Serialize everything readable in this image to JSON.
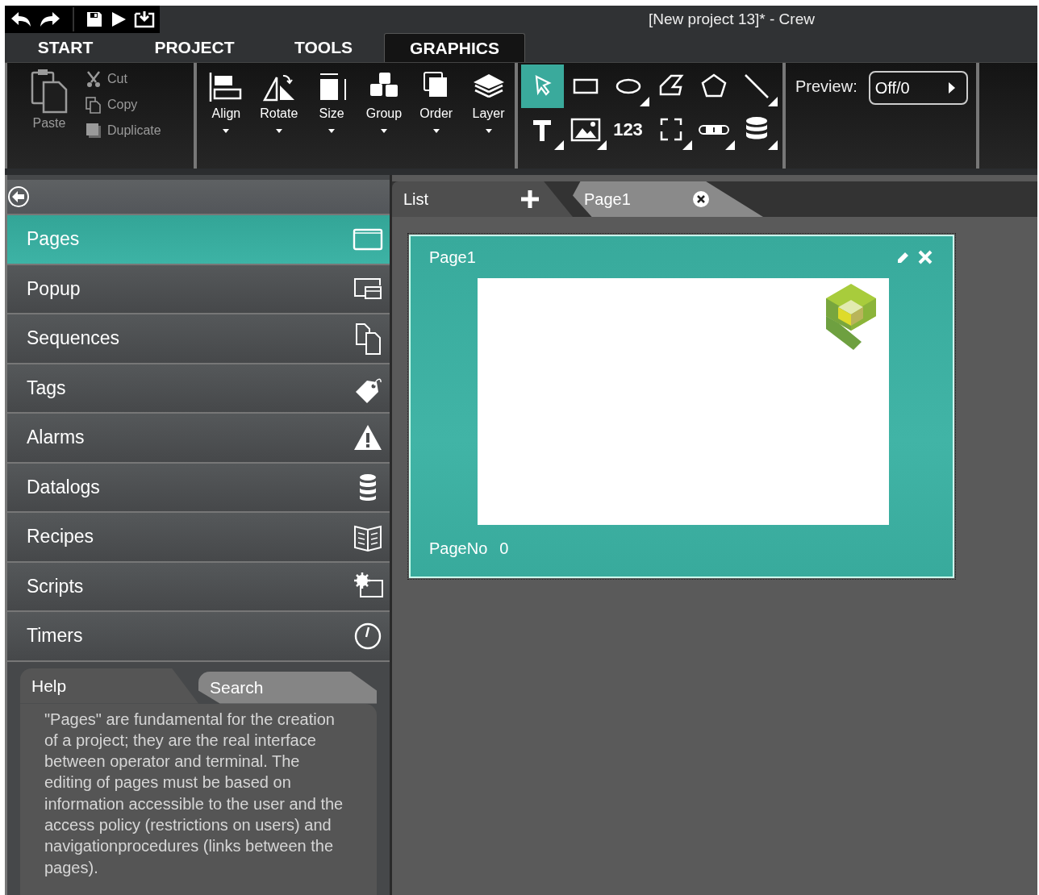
{
  "window": {
    "title": "[New project 13]* - Crew"
  },
  "ribbon_tabs": [
    {
      "label": "START",
      "selected": false
    },
    {
      "label": "PROJECT",
      "selected": false
    },
    {
      "label": "TOOLS",
      "selected": false
    },
    {
      "label": "GRAPHICS",
      "selected": true
    }
  ],
  "clipboard": {
    "paste": {
      "label": "Paste",
      "disabled": true
    },
    "items": [
      {
        "kind": "cut",
        "label": "Cut",
        "disabled": true
      },
      {
        "kind": "copy",
        "label": "Copy",
        "disabled": true
      },
      {
        "kind": "duplicate",
        "label": "Duplicate",
        "disabled": true
      }
    ]
  },
  "arrange": [
    {
      "kind": "align",
      "label": "Align"
    },
    {
      "kind": "rotate",
      "label": "Rotate"
    },
    {
      "kind": "size",
      "label": "Size"
    },
    {
      "kind": "group",
      "label": "Group"
    },
    {
      "kind": "order",
      "label": "Order"
    },
    {
      "kind": "layer",
      "label": "Layer"
    }
  ],
  "tools": [
    {
      "kind": "pointer",
      "selected": true,
      "has_menu": false
    },
    {
      "kind": "rectangle",
      "selected": false,
      "has_menu": false
    },
    {
      "kind": "ellipse",
      "selected": false,
      "has_menu": true
    },
    {
      "kind": "polyline",
      "selected": false,
      "has_menu": false
    },
    {
      "kind": "polygon",
      "selected": false,
      "has_menu": false
    },
    {
      "kind": "line",
      "selected": false,
      "has_menu": true
    },
    {
      "kind": "text",
      "selected": false,
      "has_menu": true
    },
    {
      "kind": "image",
      "selected": false,
      "has_menu": true
    },
    {
      "kind": "numeric",
      "label": "123",
      "selected": false,
      "has_menu": false
    },
    {
      "kind": "frame",
      "selected": false,
      "has_menu": true
    },
    {
      "kind": "slider",
      "selected": false,
      "has_menu": true
    },
    {
      "kind": "database",
      "selected": false,
      "has_menu": true
    }
  ],
  "preview": {
    "label": "Preview:",
    "value": "Off/0"
  },
  "sidebar": {
    "items": [
      {
        "kind": "pages",
        "label": "Pages",
        "selected": true
      },
      {
        "kind": "popup",
        "label": "Popup",
        "selected": false
      },
      {
        "kind": "sequences",
        "label": "Sequences",
        "selected": false
      },
      {
        "kind": "tags",
        "label": "Tags",
        "selected": false
      },
      {
        "kind": "alarms",
        "label": "Alarms",
        "selected": false
      },
      {
        "kind": "datalogs",
        "label": "Datalogs",
        "selected": false
      },
      {
        "kind": "recipes",
        "label": "Recipes",
        "selected": false
      },
      {
        "kind": "scripts",
        "label": "Scripts",
        "selected": false
      },
      {
        "kind": "timers",
        "label": "Timers",
        "selected": false
      }
    ]
  },
  "help": {
    "tabs": [
      {
        "label": "Help",
        "selected": true
      },
      {
        "label": "Search",
        "selected": false
      }
    ],
    "text": "\"Pages\" are fundamental for the creation of a project; they are the real interface between operator and terminal. The editing of pages must be based on information accessible to the user and the access policy (restrictions on users) and navigationprocedures (links between the pages)."
  },
  "editor_tabs": [
    {
      "kind": "list",
      "label": "List",
      "selected": false
    },
    {
      "kind": "page",
      "label": "Page1",
      "selected": true
    }
  ],
  "page_card": {
    "title": "Page1",
    "page_no_label": "PageNo",
    "page_no": "0"
  }
}
